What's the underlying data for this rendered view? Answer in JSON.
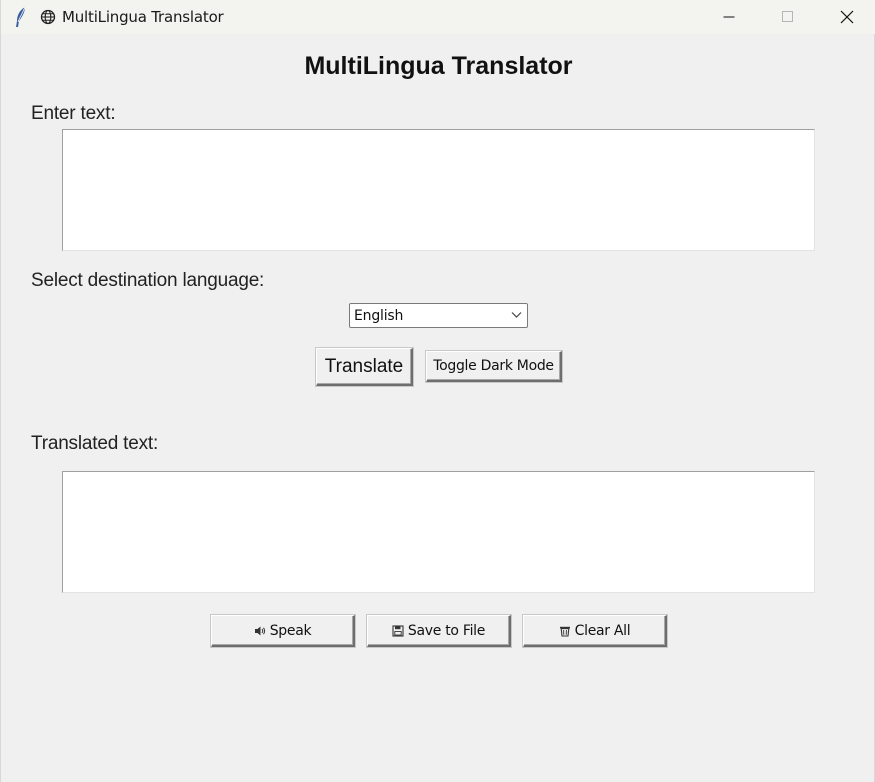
{
  "window": {
    "title": "MultiLingua Translator",
    "icons": [
      "feather-icon",
      "globe-icon"
    ],
    "controls": [
      "minimize",
      "maximize",
      "close"
    ]
  },
  "app": {
    "heading": "MultiLingua Translator"
  },
  "input": {
    "label": "Enter text:",
    "value": ""
  },
  "language": {
    "label": "Select destination language:",
    "selected": "English"
  },
  "actions": {
    "translate_label": "Translate",
    "dark_mode_label": "Toggle Dark Mode"
  },
  "output": {
    "label": "Translated text:",
    "value": ""
  },
  "bottom_buttons": {
    "speak_label": "Speak",
    "save_label": "Save to File",
    "clear_label": "Clear All",
    "speak_icon": "speaker-icon",
    "save_icon": "floppy-disk-icon",
    "clear_icon": "wastebasket-icon"
  },
  "colors": {
    "background": "#f0f0f0",
    "titlebar": "#f3f3ef",
    "textbox": "#ffffff"
  }
}
